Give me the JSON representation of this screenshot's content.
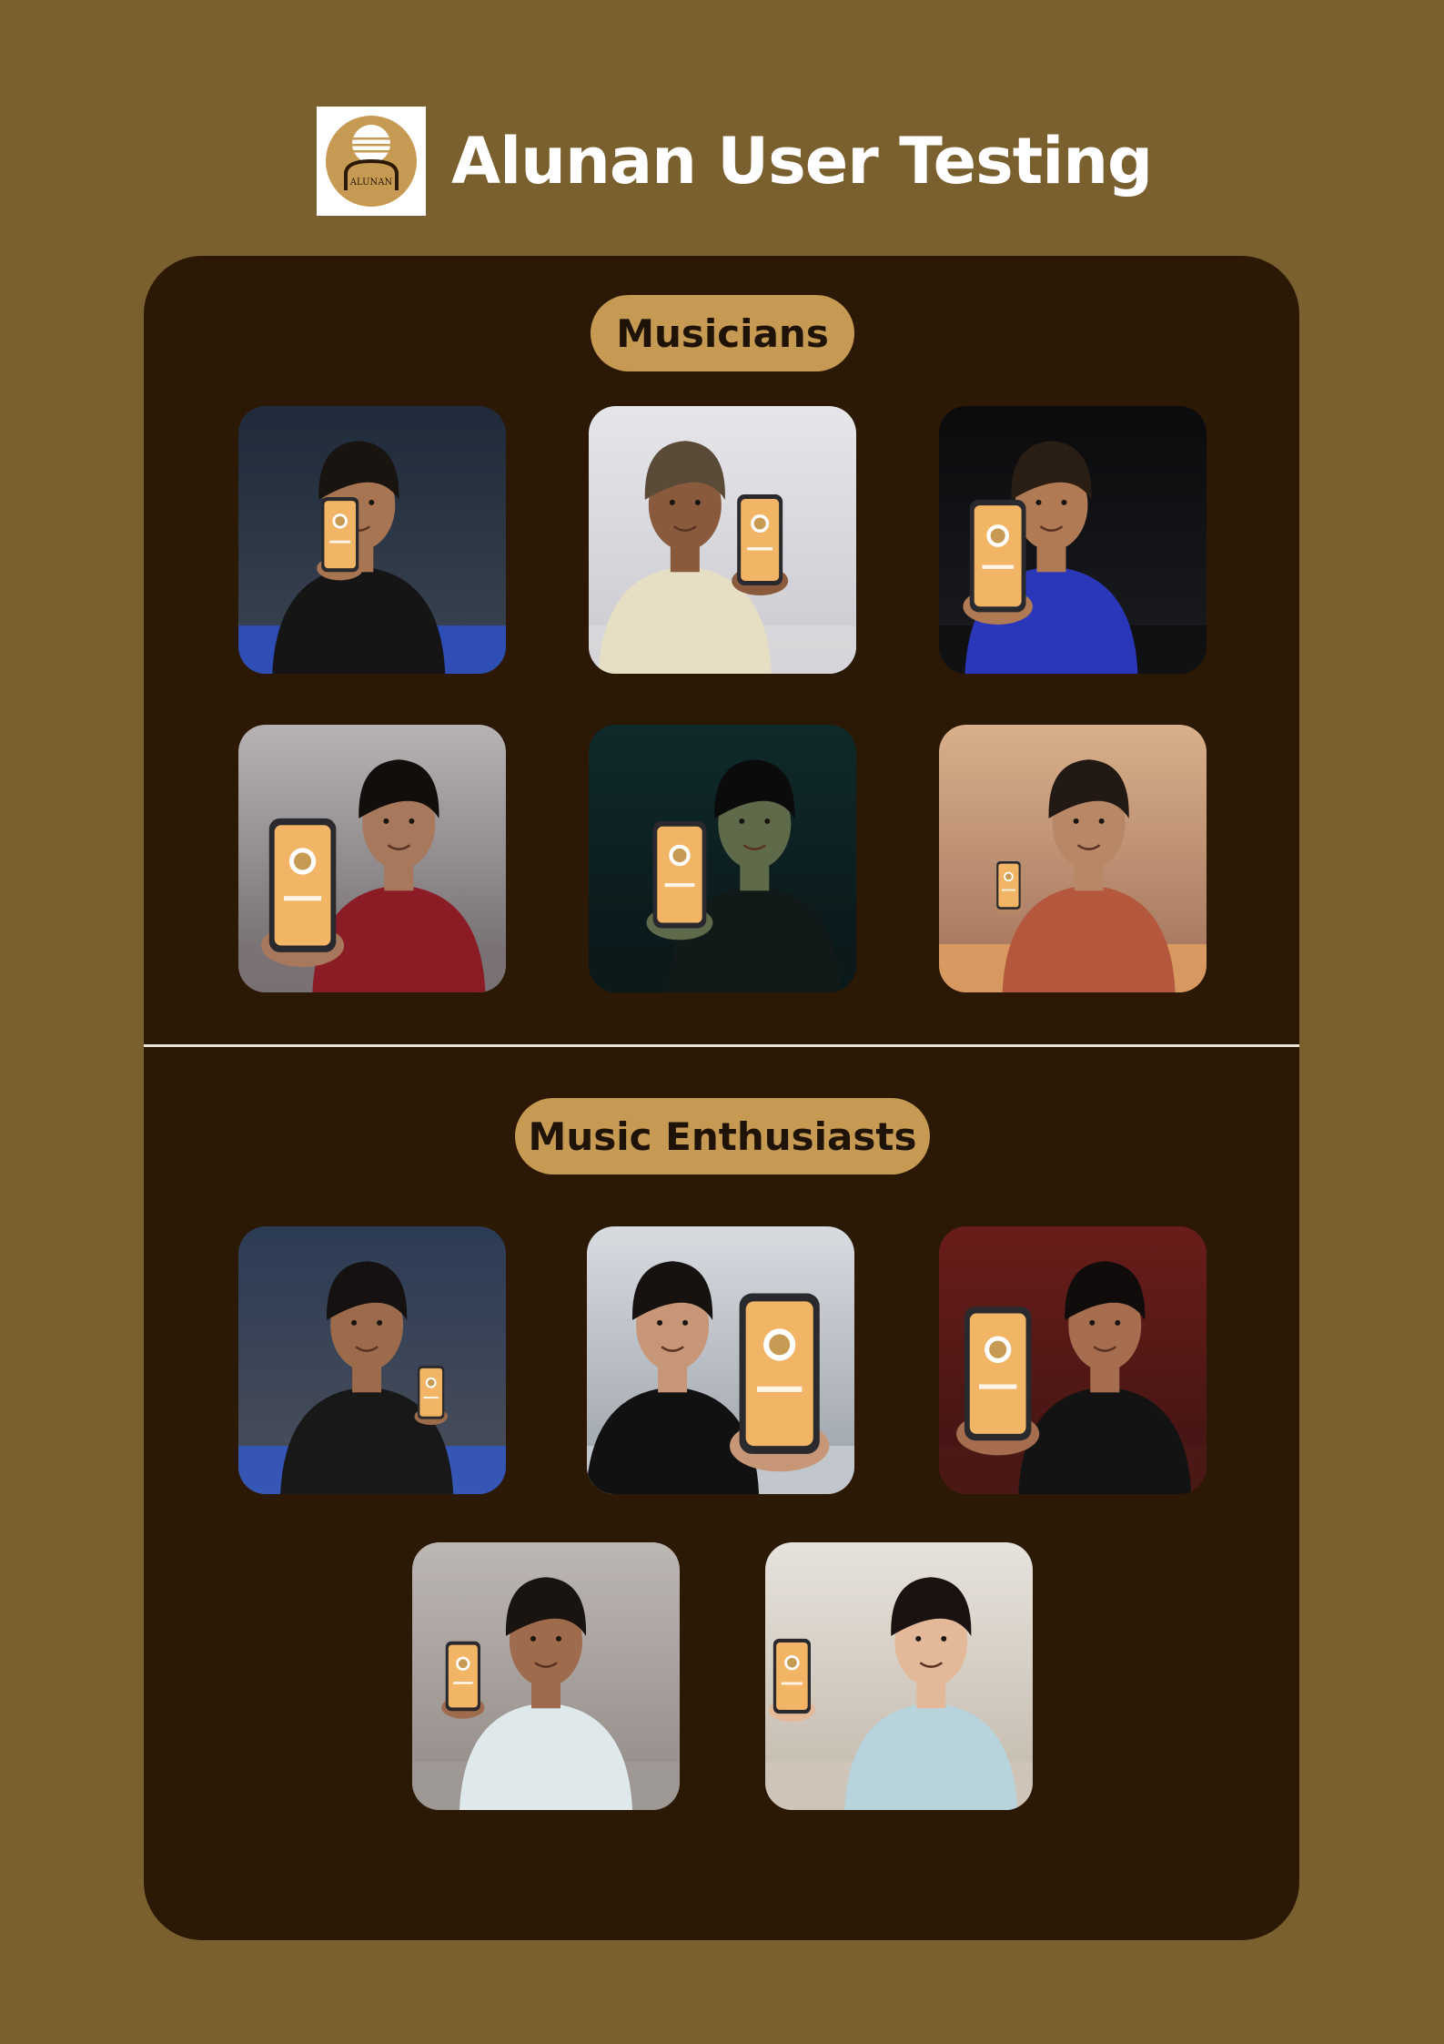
{
  "header": {
    "title": "Alunan User Testing",
    "logo_text": "ALUNAN",
    "logo_colors": {
      "gold": "#c69a52",
      "dark": "#2b1805",
      "background": "#ffffff"
    }
  },
  "colors": {
    "page_background": "#7b602f",
    "panel_background": "#2b1805",
    "pill_background": "#c69a52",
    "pill_text": "#1e1306",
    "divider": "#ece3d5",
    "phone_screen": "#f2b565"
  },
  "sections": [
    {
      "label": "Musicians",
      "photos": [
        {
          "bg": [
            "#1f2a3a",
            "#3b4552"
          ],
          "skin": "#a87552",
          "shirt": "#151515",
          "hair": "#1a1410",
          "floor": "#2d50c8"
        },
        {
          "bg": [
            "#e6e6ea",
            "#c9c9cf"
          ],
          "skin": "#8a5a3c",
          "shirt": "#e7dfc4",
          "hair": "#5a4a38",
          "floor": "#d8d8dc"
        },
        {
          "bg": [
            "#0b0b0d",
            "#1a1c20"
          ],
          "skin": "#b07a55",
          "shirt": "#2a37b8",
          "hair": "#2a1d14",
          "floor": "#0f0f12"
        }
      ]
    },
    {
      "label": "Musicians",
      "photos": [
        {
          "bg": [
            "#b7b2b4",
            "#6d6769"
          ],
          "skin": "#a8785c",
          "shirt": "#8b1c26",
          "hair": "#120e0c",
          "floor": "#7a7274"
        },
        {
          "bg": [
            "#0f2a2a",
            "#0a1618"
          ],
          "skin": "#5f6a4a",
          "shirt": "#111a18",
          "hair": "#0b0b0b",
          "floor": "#0c1a1b"
        },
        {
          "bg": [
            "#d9b08a",
            "#a0705a"
          ],
          "skin": "#b88866",
          "shirt": "#b4573c",
          "hair": "#221814",
          "floor": "#e0a060"
        }
      ]
    },
    {
      "label": "Music Enthusiasts",
      "photos": [
        {
          "bg": [
            "#2c3b55",
            "#4b4f5a"
          ],
          "skin": "#9c6b4b",
          "shirt": "#181818",
          "hair": "#151110",
          "floor": "#3258c6"
        },
        {
          "bg": [
            "#d8dbe0",
            "#9aa0a8"
          ],
          "skin": "#c79676",
          "shirt": "#111111",
          "hair": "#161210",
          "floor": "#c8ccd2"
        },
        {
          "bg": [
            "#6a1d1a",
            "#3e1412"
          ],
          "skin": "#a66e4e",
          "shirt": "#131313",
          "hair": "#0f0c0b",
          "floor": "#4c1a16"
        },
        {
          "bg": [
            "#bdb7b3",
            "#908985"
          ],
          "skin": "#9e6b4c",
          "shirt": "#dfe8ea",
          "hair": "#1a1411",
          "floor": "#a09a96"
        },
        {
          "bg": [
            "#e6e2dc",
            "#c2b8aa"
          ],
          "skin": "#e3b99a",
          "shirt": "#b7d4dc",
          "hair": "#1a1210",
          "floor": "#d0c6ba"
        }
      ]
    }
  ]
}
